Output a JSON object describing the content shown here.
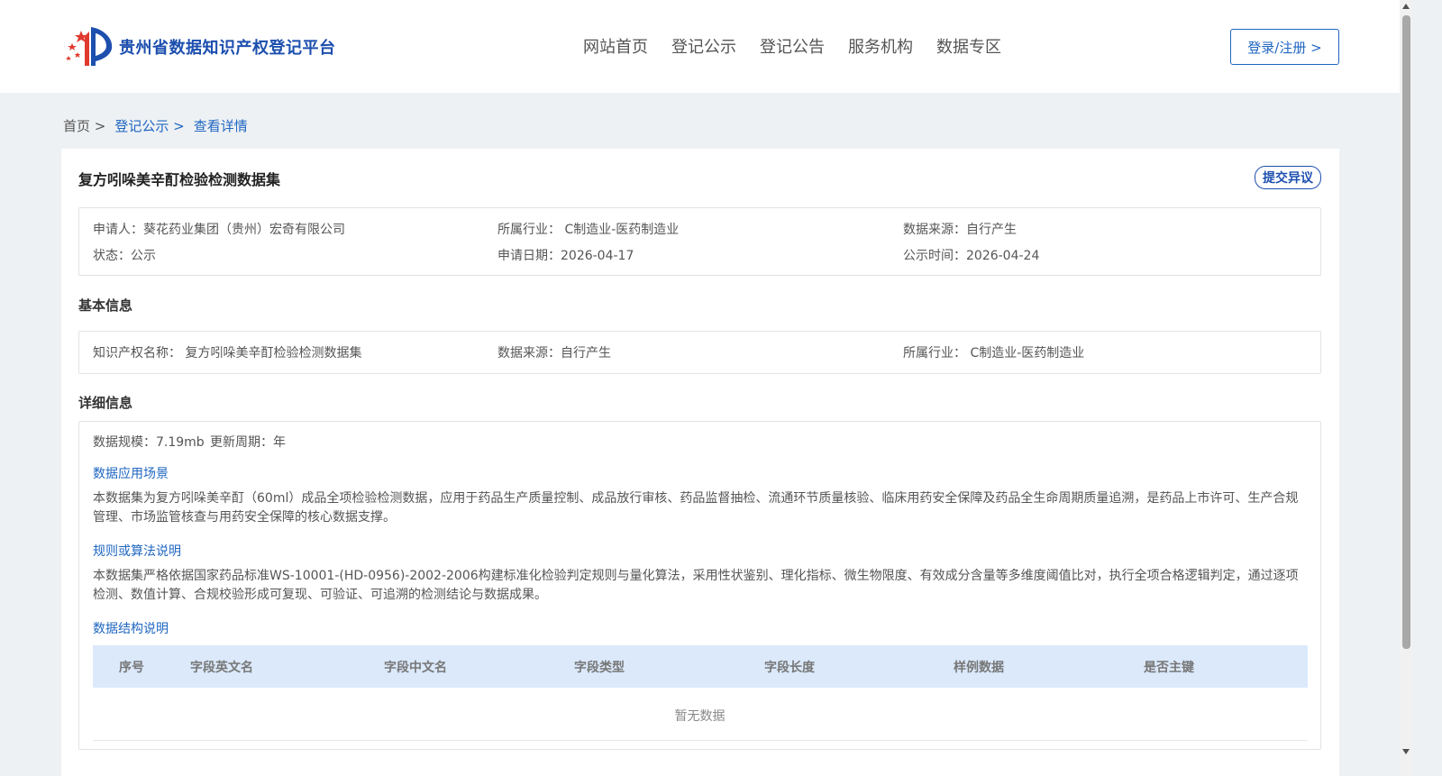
{
  "header": {
    "logo_text": "贵州省数据知识产权登记平台",
    "nav": [
      "网站首页",
      "登记公示",
      "登记公告",
      "服务机构",
      "数据专区"
    ],
    "login_label": "登录/注册 >"
  },
  "breadcrumb": {
    "home": "首页 >",
    "items": [
      "登记公示 >",
      "查看详情"
    ]
  },
  "detail": {
    "title": "复方吲哚美辛酊检验检测数据集",
    "objection_label": "提交异议",
    "info": {
      "applicant": "申请人：葵花药业集团（贵州）宏奇有限公司",
      "industry": "所属行业： C制造业-医药制造业",
      "source": "数据来源：自行产生",
      "status": "状态：公示",
      "apply_date": "申请日期：2026-04-17",
      "publicity_time": "公示时间：2026-04-24"
    },
    "basic_title": "基本信息",
    "basic": {
      "ip_name": "知识产权名称： 复方吲哚美辛酊检验检测数据集",
      "source": "数据来源：自行产生",
      "industry": "所属行业： C制造业-医药制造业"
    },
    "detail_title": "详细信息",
    "scale": "数据规模：7.19mb",
    "cycle": "更新周期：年",
    "scenario_label": "数据应用场景",
    "scenario_text": "本数据集为复方吲哚美辛酊（60ml）成品全项检验检测数据，应用于药品生产质量控制、成品放行审核、药品监督抽检、流通环节质量核验、临床用药安全保障及药品全生命周期质量追溯，是药品上市许可、生产合规管理、市场监管核查与用药安全保障的核心数据支撑。",
    "rules_label": "规则或算法说明",
    "rules_text": "本数据集严格依据国家药品标准WS-10001-(HD-0956)-2002-2006构建标准化检验判定规则与量化算法，采用性状鉴别、理化指标、微生物限度、有效成分含量等多维度阈值比对，执行全项合格逻辑判定，通过逐项检测、数值计算、合规校验形成可复现、可验证、可追溯的检测结论与数据成果。",
    "structure_label": "数据结构说明",
    "table_headers": [
      "序号",
      "字段英文名",
      "字段中文名",
      "字段类型",
      "字段长度",
      "样例数据",
      "是否主键"
    ],
    "empty_text": "暂无数据"
  },
  "colors": {
    "accent": "#1f66c1",
    "brand": "#1d4fae",
    "table_header_bg": "#dbe9fb",
    "page_bg": "#eef1f4"
  }
}
